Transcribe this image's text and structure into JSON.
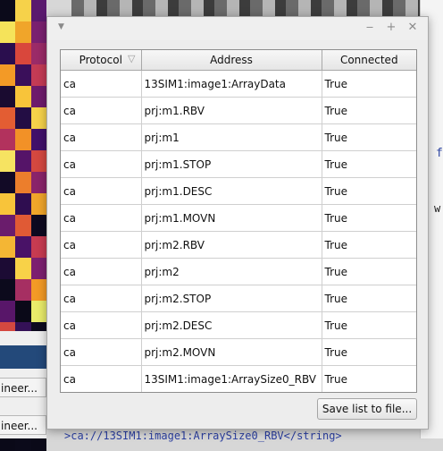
{
  "dialog": {
    "menu_icon": "triangle-down-icon",
    "controls": {
      "minimize": "minimize-icon",
      "maximize": "maximize-icon",
      "close": "close-icon"
    },
    "table": {
      "columns": [
        "Protocol",
        "Address",
        "Connected"
      ],
      "sort_icon": "sort-triangle-icon",
      "rows": [
        {
          "protocol": "ca",
          "address": "13SIM1:image1:ArrayData",
          "connected": "True"
        },
        {
          "protocol": "ca",
          "address": "prj:m1.RBV",
          "connected": "True"
        },
        {
          "protocol": "ca",
          "address": "prj:m1",
          "connected": "True"
        },
        {
          "protocol": "ca",
          "address": "prj:m1.STOP",
          "connected": "True"
        },
        {
          "protocol": "ca",
          "address": "prj:m1.DESC",
          "connected": "True"
        },
        {
          "protocol": "ca",
          "address": "prj:m1.MOVN",
          "connected": "True"
        },
        {
          "protocol": "ca",
          "address": "prj:m2.RBV",
          "connected": "True"
        },
        {
          "protocol": "ca",
          "address": "prj:m2",
          "connected": "True"
        },
        {
          "protocol": "ca",
          "address": "prj:m2.STOP",
          "connected": "True"
        },
        {
          "protocol": "ca",
          "address": "prj:m2.DESC",
          "connected": "True"
        },
        {
          "protocol": "ca",
          "address": "prj:m2.MOVN",
          "connected": "True"
        },
        {
          "protocol": "ca",
          "address": "13SIM1:image1:ArraySize0_RBV",
          "connected": "True"
        }
      ]
    },
    "save_button_label": "Save list to file..."
  },
  "background": {
    "button_1_label": "ineer...",
    "button_2_label": "ineer...",
    "code_text": ">ca://13SIM1:image1:ArraySize0_RBV</string>",
    "right_glyph_1": "f",
    "right_glyph_2": "w",
    "heatmap_colors": [
      "#0b0a1a",
      "#f6d24a",
      "#5a1a6e",
      "#f5e35a",
      "#f0a52a",
      "#7a2170",
      "#2a0e4e",
      "#d9473c",
      "#9b2b68",
      "#f39a26",
      "#3a0f5a",
      "#c43b55",
      "#1a0b30",
      "#f8c43a",
      "#6e1b6c",
      "#e35d33",
      "#230d44",
      "#f6d24a",
      "#b2325d",
      "#f29127",
      "#41106a",
      "#f6e361",
      "#551468",
      "#d44840",
      "#120a26",
      "#ec7e2c",
      "#8a246a",
      "#f8c43a",
      "#2f0d50",
      "#f0a52a",
      "#6a1c6c",
      "#e05a35",
      "#0e0920",
      "#f4b634",
      "#491267",
      "#c73b51",
      "#1c0b34",
      "#f8d248",
      "#7d2070",
      "#0c0a1c",
      "#a62f62",
      "#f39a26",
      "#581669",
      "#0a0918",
      "#e9ec6a",
      "#d44840",
      "#341157",
      "#0d0a1e",
      "#f6d24a",
      "#160a2a",
      "#8a246a",
      "#090817",
      "#5a1a6e",
      "#f0a52a",
      "#a62f62",
      "#0b0a1a",
      "#0a0918",
      "#0b0a1a",
      "#0a0918",
      "#0b0a1a",
      "#0a0918",
      "#0b0a1a",
      "#0a0918"
    ]
  }
}
